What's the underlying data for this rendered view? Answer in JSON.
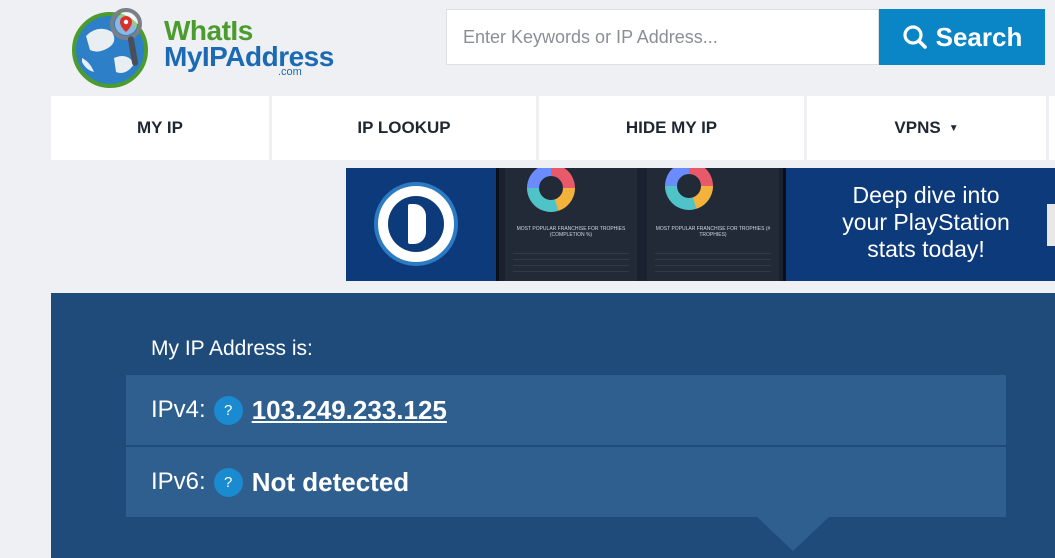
{
  "logo": {
    "line1": "WhatIs",
    "line2": "MyIPAddress",
    "dotcom": ".com"
  },
  "search": {
    "placeholder": "Enter Keywords or IP Address...",
    "button_label": "Search"
  },
  "nav": {
    "my_ip": "MY IP",
    "ip_lookup": "IP LOOKUP",
    "hide_my_ip": "HIDE MY IP",
    "vpns": "VPNS",
    "vpns_caret": "▼"
  },
  "banner": {
    "line1": "Deep dive into",
    "line2": "your PlayStation",
    "line3": "stats today!",
    "panel1_title": "MOST POPULAR FRANCHISE FOR TROPHIES (COMPLETION %)",
    "panel2_title": "MOST POPULAR FRANCHISE FOR TROPHIES (# TROPHIES)"
  },
  "ip": {
    "heading": "My IP Address is:",
    "ipv4_label": "IPv4:",
    "ipv4_value": "103.249.233.125",
    "ipv6_label": "IPv6:",
    "ipv6_value": "Not detected",
    "help_glyph": "?"
  },
  "colors": {
    "search_button": "#0a85c6",
    "ip_panel": "#1f4b7a",
    "ip_row": "#2e5f8e",
    "help_badge": "#1a8bd1",
    "banner_bg": "#0d3a7a"
  }
}
